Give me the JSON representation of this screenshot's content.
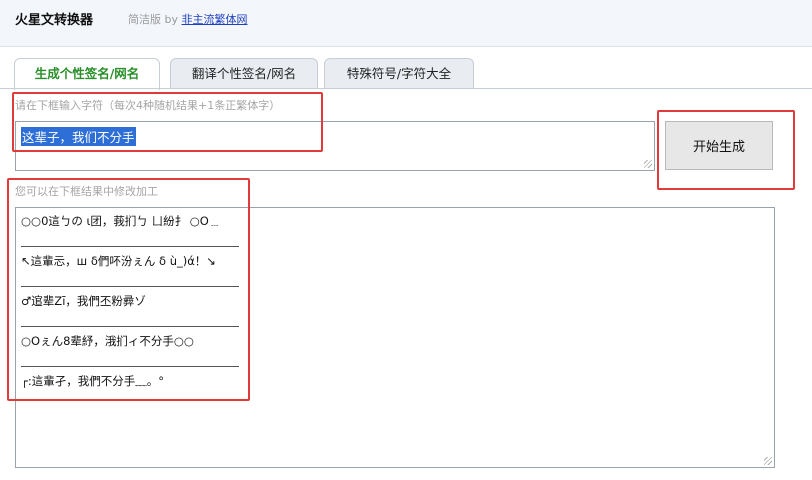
{
  "header": {
    "title": "火星文转换器",
    "edition": "简洁版 by",
    "site_link": "非主流繁体网"
  },
  "tabs": [
    {
      "label": "生成个性签名/网名",
      "active": true
    },
    {
      "label": "翻译个性签名/网名",
      "active": false
    },
    {
      "label": "特殊符号/字符大全",
      "active": false
    }
  ],
  "input": {
    "hint": "请在下框输入字符（每次4种随机结果+1条正繁体字）",
    "value": "这辈子，我们不分手"
  },
  "generate_button": "开始生成",
  "output": {
    "hint": "您可以在下框结果中修改加工",
    "lines": [
      "○○0這ㄅの ι团，莪扪ㄅ ㄩ紛扌 ○O﹍",
      "____________________",
      "↖這輩忈，ш δ們吥汾ぇん δ ù_)ά！↘",
      "____________________",
      "♂逭辈Ζī，我們丕粉彛ゾ",
      "____________________",
      "○Oぇん8辈紓，涐扪ィ不分手○○",
      "____________________",
      "┌:這輩孑，我們不分手﹏。°"
    ]
  },
  "colors": {
    "annotation_box": "#e23a3a",
    "active_tab_text": "#2a8f2a",
    "selection_bg": "#2d6fd6"
  }
}
